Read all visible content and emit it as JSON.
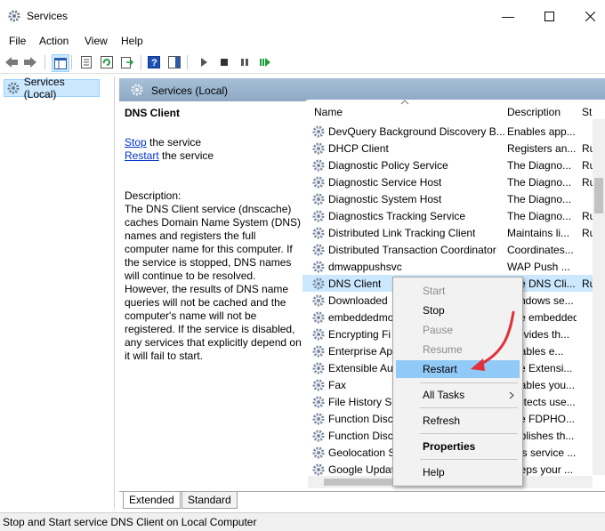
{
  "window": {
    "title": "Services"
  },
  "menu": [
    "File",
    "Action",
    "View",
    "Help"
  ],
  "tree": {
    "root": "Services (Local)"
  },
  "header": {
    "title": "Services (Local)"
  },
  "details": {
    "service_name": "DNS Client",
    "stop_link": "Stop",
    "stop_rest": " the service",
    "restart_link": "Restart",
    "restart_rest": " the service",
    "description_label": "Description:",
    "description": "The DNS Client service (dnscache) caches Domain Name System (DNS) names and registers the full computer name for this computer. If the service is stopped, DNS names will continue to be resolved. However, the results of DNS name queries will not be cached and the computer's name will not be registered. If the service is disabled, any services that explicitly depend on it will fail to start."
  },
  "columns": {
    "name": "Name",
    "description": "Description",
    "status": "St"
  },
  "rows": [
    {
      "name": "DevQuery Background Discovery B...",
      "desc": "Enables app...",
      "status": ""
    },
    {
      "name": "DHCP Client",
      "desc": "Registers an...",
      "status": "Ru"
    },
    {
      "name": "Diagnostic Policy Service",
      "desc": "The Diagno...",
      "status": "Ru"
    },
    {
      "name": "Diagnostic Service Host",
      "desc": "The Diagno...",
      "status": "Ru"
    },
    {
      "name": "Diagnostic System Host",
      "desc": "The Diagno...",
      "status": ""
    },
    {
      "name": "Diagnostics Tracking Service",
      "desc": "The Diagno...",
      "status": "Ru"
    },
    {
      "name": "Distributed Link Tracking Client",
      "desc": "Maintains li...",
      "status": "Ru"
    },
    {
      "name": "Distributed Transaction Coordinator",
      "desc": "Coordinates...",
      "status": ""
    },
    {
      "name": "dmwappushsvc",
      "desc": "WAP Push ...",
      "status": ""
    },
    {
      "name": "DNS Client",
      "desc": "The DNS Cli...",
      "status": "Ru"
    },
    {
      "name": "Downloaded",
      "desc": "Windows se...",
      "status": ""
    },
    {
      "name": "embeddedmo",
      "desc": "The embedded...",
      "status": ""
    },
    {
      "name": "Encrypting Fi",
      "desc": "Provides th...",
      "status": ""
    },
    {
      "name": "Enterprise Ap",
      "desc": "Enables e...",
      "status": ""
    },
    {
      "name": "Extensible Au",
      "desc": "The Extensi...",
      "status": ""
    },
    {
      "name": "Fax",
      "desc": "Enables you...",
      "status": ""
    },
    {
      "name": "File History S",
      "desc": "Protects use...",
      "status": ""
    },
    {
      "name": "Function Disc",
      "desc": "The FDPHO...",
      "status": ""
    },
    {
      "name": "Function Disc",
      "desc": "Publishes th...",
      "status": ""
    },
    {
      "name": "Geolocation S",
      "desc": "This service ...",
      "status": ""
    },
    {
      "name": "Google Updat",
      "desc": "Keeps your ...",
      "status": ""
    }
  ],
  "context_menu": {
    "start": "Start",
    "stop": "Stop",
    "pause": "Pause",
    "resume": "Resume",
    "restart": "Restart",
    "all_tasks": "All Tasks",
    "refresh": "Refresh",
    "properties": "Properties",
    "help": "Help"
  },
  "tabs": {
    "extended": "Extended",
    "standard": "Standard"
  },
  "status_bar": "Stop and Start service DNS Client on Local Computer",
  "colors": {
    "selection": "#cce8ff",
    "menu_highlight": "#91c9f7",
    "arrow": "#e0303a",
    "link": "#0033cc"
  }
}
